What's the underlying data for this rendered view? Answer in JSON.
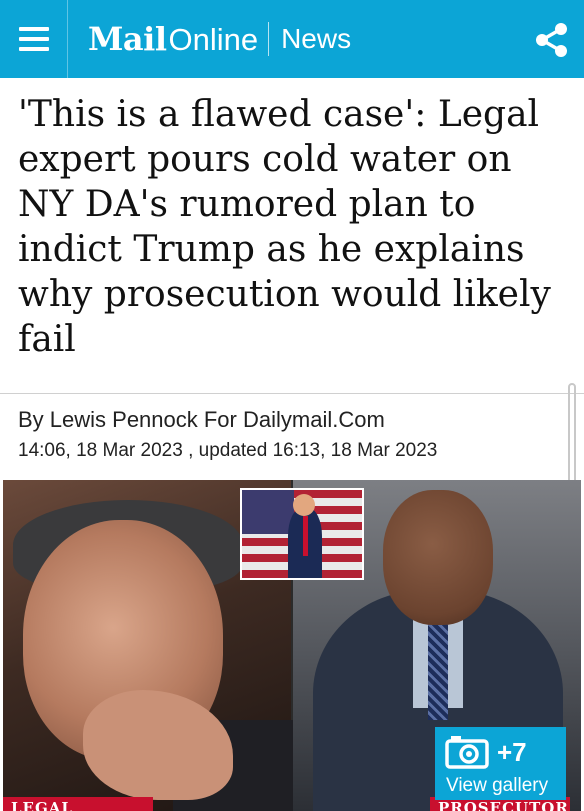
{
  "header": {
    "brand_mail": "Mail",
    "brand_online": "Online",
    "section": "News",
    "background_color": "#0ca5d6",
    "menu_icon": "hamburger-menu-icon",
    "share_icon": "share-icon"
  },
  "article": {
    "headline": "'This is a flawed case': Legal expert pours cold water on NY DA's rumored plan to indict Trump as he explains why prosecution would likely fail",
    "byline": "By Lewis Pennock For Dailymail.Com",
    "dateline": "14:06, 18 Mar 2023 , updated 16:13, 18 Mar 2023"
  },
  "hero": {
    "left_caption": "LEGAL EXPERT",
    "right_caption": "PROSECUTOR",
    "gallery": {
      "count": "+7",
      "label": "View gallery",
      "icon": "camera-icon"
    }
  }
}
